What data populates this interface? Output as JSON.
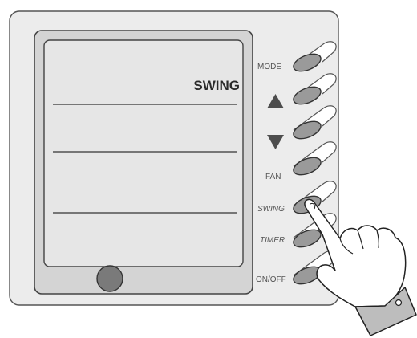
{
  "display": {
    "swing_text": "SWING"
  },
  "buttons": {
    "mode": "MODE",
    "up_icon": "triangle-up",
    "down_icon": "triangle-down",
    "fan": "FAN",
    "swing": "SWING",
    "timer": "TIMER",
    "onoff": "ON/OFF"
  },
  "colors": {
    "panel": "#ececec",
    "screen": "#d4d4d4",
    "screen_inner": "#e6e6e6",
    "button": "#9a9a9a",
    "arrow": "#4d4d4d",
    "hand_cuff": "#bdbdbd"
  }
}
